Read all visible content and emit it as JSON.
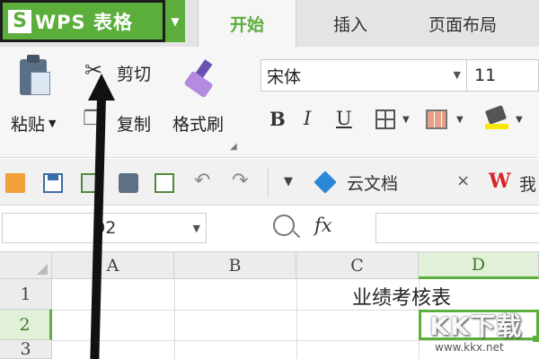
{
  "titlebar": {
    "app_logo": "S",
    "app_name": "WPS 表格",
    "tabs": [
      {
        "label": "开始",
        "active": true
      },
      {
        "label": "插入",
        "active": false
      },
      {
        "label": "页面布局",
        "active": false
      }
    ]
  },
  "ribbon": {
    "paste_label": "粘贴",
    "cut_label": "剪切",
    "copy_label": "复制",
    "format_painter_label": "格式刷",
    "font_name": "宋体",
    "font_size": "11",
    "bold_label": "B",
    "italic_label": "I",
    "underline_label": "U"
  },
  "quick_access": {
    "cloud_doc_label": "云文档",
    "close_glyph": "×",
    "wps_logo": "W",
    "wps_partial_label": "我"
  },
  "formula_bar": {
    "cell_ref": "D2",
    "fx_label": "fx",
    "formula": ""
  },
  "sheet": {
    "columns": [
      "A",
      "B",
      "C",
      "D"
    ],
    "active_column": "D",
    "rows": [
      "1",
      "2",
      "3"
    ],
    "active_row": "2",
    "cells": {
      "C1": "业绩考核表"
    },
    "selected_cell": "D2"
  },
  "watermark": {
    "logo": "KK下载",
    "url": "www.kkx.net"
  },
  "colors": {
    "accent_green": "#5cae3c",
    "wps_red": "#d8232a",
    "cloud_blue": "#2b88d8"
  },
  "icons": [
    "paste-icon",
    "scissors-icon",
    "copy-icon",
    "format-painter-icon",
    "border-icon",
    "cell-style-icon",
    "fill-color-icon",
    "open-icon",
    "save-icon",
    "export-icon",
    "print-icon",
    "preview-icon",
    "undo-icon",
    "redo-icon",
    "cloud-doc-icon",
    "zoom-icon"
  ]
}
